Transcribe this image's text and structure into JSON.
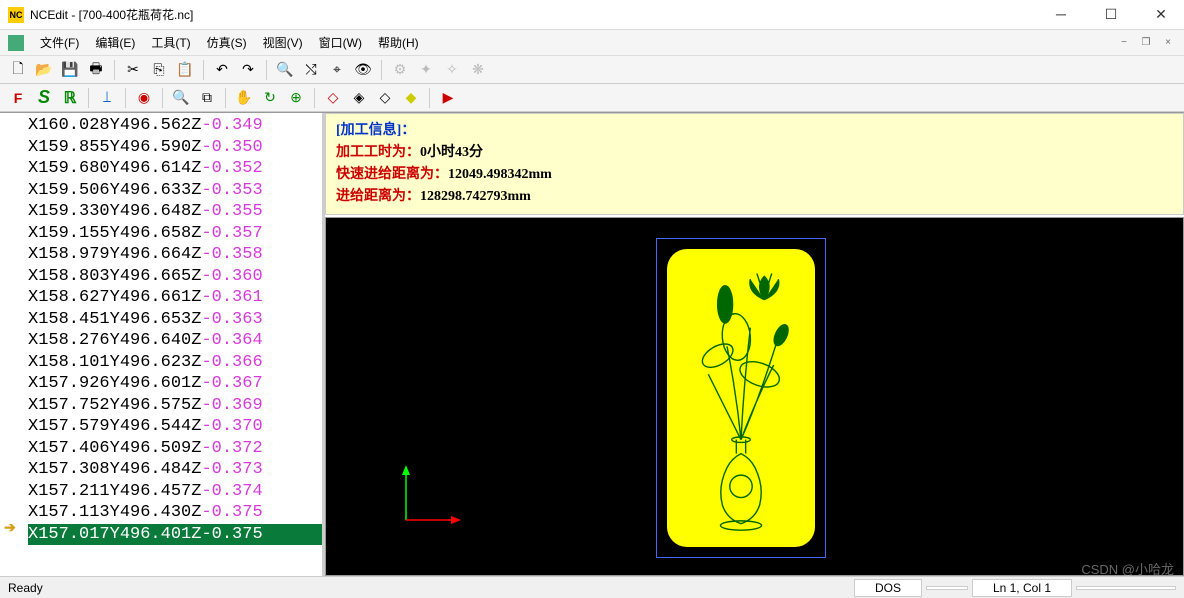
{
  "title": "NCEdit - [700-400花瓶荷花.nc]",
  "menu": [
    "文件(F)",
    "编辑(E)",
    "工具(T)",
    "仿真(S)",
    "视图(V)",
    "窗口(W)",
    "帮助(H)"
  ],
  "toolbar1": {
    "new": "new-icon",
    "open": "open-icon",
    "save": "save-icon",
    "print": "print-icon",
    "cut": "cut-icon",
    "copy": "copy-icon",
    "paste": "paste-icon",
    "undo": "undo-icon",
    "redo": "redo-icon",
    "find": "find-icon",
    "next": "next-icon",
    "bookmark": "bookmark-icon",
    "t1": "tool1-icon",
    "t2": "tool2-icon",
    "t3": "tool3-icon",
    "t4": "tool4-icon"
  },
  "toolbar2": {
    "fs": "F S",
    "fr": "F R",
    "tool": "T",
    "zoom": "zoom-icon",
    "zoomwin": "zoom-window-icon",
    "pan": "pan-icon",
    "rotate": "rotate-icon",
    "fit": "fit-icon",
    "iso1": "iso1",
    "iso2": "iso2",
    "iso3": "iso3",
    "iso4": "iso4",
    "play": "play-icon"
  },
  "code": [
    {
      "xy": "X160.028Y496.562Z",
      "z": "-0.349"
    },
    {
      "xy": "X159.855Y496.590Z",
      "z": "-0.350"
    },
    {
      "xy": "X159.680Y496.614Z",
      "z": "-0.352"
    },
    {
      "xy": "X159.506Y496.633Z",
      "z": "-0.353"
    },
    {
      "xy": "X159.330Y496.648Z",
      "z": "-0.355"
    },
    {
      "xy": "X159.155Y496.658Z",
      "z": "-0.357"
    },
    {
      "xy": "X158.979Y496.664Z",
      "z": "-0.358"
    },
    {
      "xy": "X158.803Y496.665Z",
      "z": "-0.360"
    },
    {
      "xy": "X158.627Y496.661Z",
      "z": "-0.361"
    },
    {
      "xy": "X158.451Y496.653Z",
      "z": "-0.363"
    },
    {
      "xy": "X158.276Y496.640Z",
      "z": "-0.364"
    },
    {
      "xy": "X158.101Y496.623Z",
      "z": "-0.366"
    },
    {
      "xy": "X157.926Y496.601Z",
      "z": "-0.367"
    },
    {
      "xy": "X157.752Y496.575Z",
      "z": "-0.369"
    },
    {
      "xy": "X157.579Y496.544Z",
      "z": "-0.370"
    },
    {
      "xy": "X157.406Y496.509Z",
      "z": "-0.372"
    },
    {
      "xy": "X157.308Y496.484Z",
      "z": "-0.373"
    },
    {
      "xy": "X157.211Y496.457Z",
      "z": "-0.374"
    },
    {
      "xy": "X157.113Y496.430Z",
      "z": "-0.375"
    },
    {
      "xy": "X157.017Y496.401Z",
      "z": "-0.375",
      "current": true
    }
  ],
  "info": {
    "header": "[加工信息]：",
    "time_label": "加工工时为：",
    "time_value": "0小时43分",
    "rapid_label": "快速进给距离为：",
    "rapid_value": "12049.498342mm",
    "feed_label": "进给距离为：",
    "feed_value": "128298.742793mm"
  },
  "status": {
    "ready": "Ready",
    "encoding": "DOS",
    "pos": "Ln 1, Col 1"
  },
  "watermark": "CSDN @小哈龙"
}
